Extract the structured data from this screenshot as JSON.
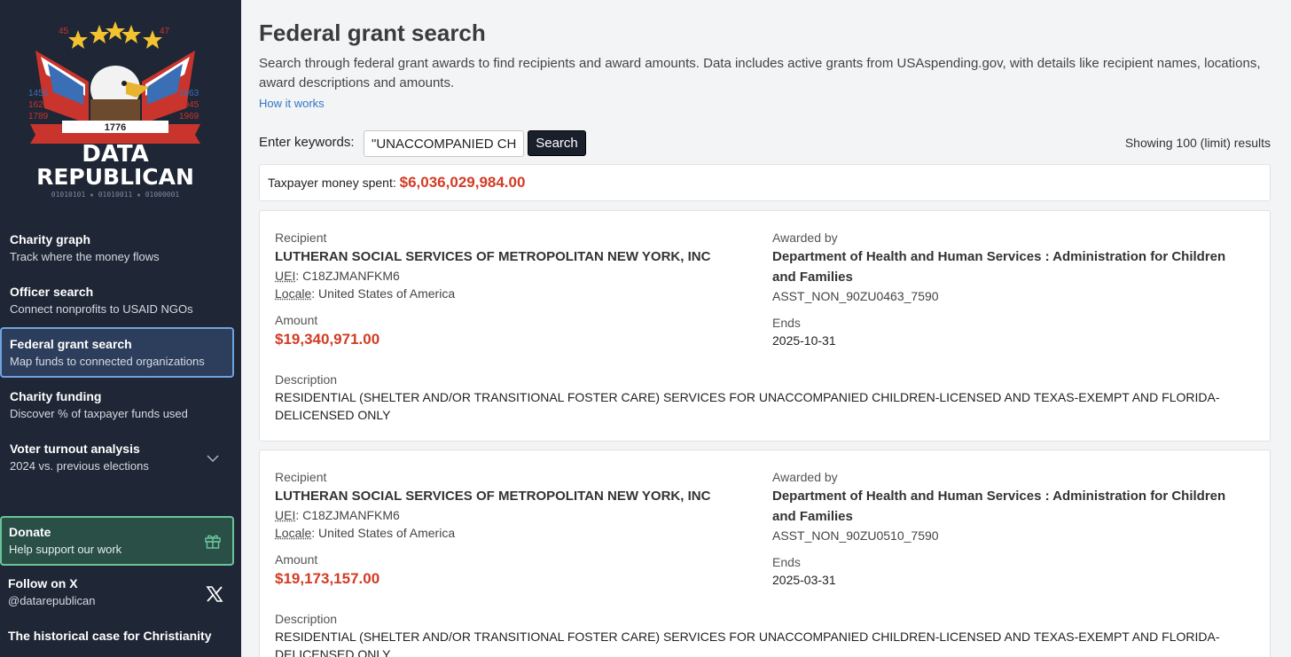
{
  "sidebar": {
    "logo": {
      "top_left_number": "45",
      "top_right_number": "47",
      "left_years": [
        "1455",
        "1620",
        "1789"
      ],
      "right_years": [
        "1863",
        "1945",
        "1969"
      ],
      "banner_year": "1776",
      "line1": "DATA",
      "line2": "REPUBLICAN",
      "binary": "01010101 ★ 01010011 ★ 01000001"
    },
    "nav": [
      {
        "title": "Charity graph",
        "subtitle": "Track where the money flows"
      },
      {
        "title": "Officer search",
        "subtitle": "Connect nonprofits to USAID NGOs"
      },
      {
        "title": "Federal grant search",
        "subtitle": "Map funds to connected organizations"
      },
      {
        "title": "Charity funding",
        "subtitle": "Discover % of taxpayer funds used"
      },
      {
        "title": "Voter turnout analysis",
        "subtitle": "2024 vs. previous elections"
      }
    ],
    "donate": {
      "title": "Donate",
      "subtitle": "Help support our work"
    },
    "follow": {
      "title": "Follow on X",
      "subtitle": "@datarepublican"
    },
    "historical": "The historical case for Christianity"
  },
  "main": {
    "title": "Federal grant search",
    "description": "Search through federal grant awards to find recipients and award amounts. Data includes active grants from USAspending.gov, with details like recipient names, locations, award descriptions and amounts.",
    "how_it_works": "How it works",
    "keywords_label": "Enter keywords:",
    "keywords_value": "\"UNACCOMPANIED CHI",
    "search_label": "Search",
    "showing": "Showing 100 (limit) results",
    "total_label": "Taxpayer money spent:",
    "total_amount": "$6,036,029,984.00"
  },
  "labels": {
    "recipient": "Recipient",
    "uei": "UEI",
    "locale": "Locale",
    "amount": "Amount",
    "awarded_by": "Awarded by",
    "ends": "Ends",
    "description": "Description"
  },
  "results": [
    {
      "recipient": "LUTHERAN SOCIAL SERVICES OF METROPOLITAN NEW YORK, INC",
      "uei": ": C18ZJMANFKM6",
      "locale": ": United States of America",
      "amount": "$19,340,971.00",
      "awarded_by": "Department of Health and Human Services : Administration for Children and Families",
      "award_id": "ASST_NON_90ZU0463_7590",
      "ends": "2025-10-31",
      "description": "RESIDENTIAL (SHELTER AND/OR TRANSITIONAL FOSTER CARE) SERVICES FOR UNACCOMPANIED CHILDREN-LICENSED AND TEXAS-EXEMPT AND FLORIDA-DELICENSED ONLY"
    },
    {
      "recipient": "LUTHERAN SOCIAL SERVICES OF METROPOLITAN NEW YORK, INC",
      "uei": ": C18ZJMANFKM6",
      "locale": ": United States of America",
      "amount": "$19,173,157.00",
      "awarded_by": "Department of Health and Human Services : Administration for Children and Families",
      "award_id": "ASST_NON_90ZU0510_7590",
      "ends": "2025-03-31",
      "description": "RESIDENTIAL (SHELTER AND/OR TRANSITIONAL FOSTER CARE) SERVICES FOR UNACCOMPANIED CHILDREN-LICENSED AND TEXAS-EXEMPT AND FLORIDA-DELICENSED ONLY"
    }
  ]
}
